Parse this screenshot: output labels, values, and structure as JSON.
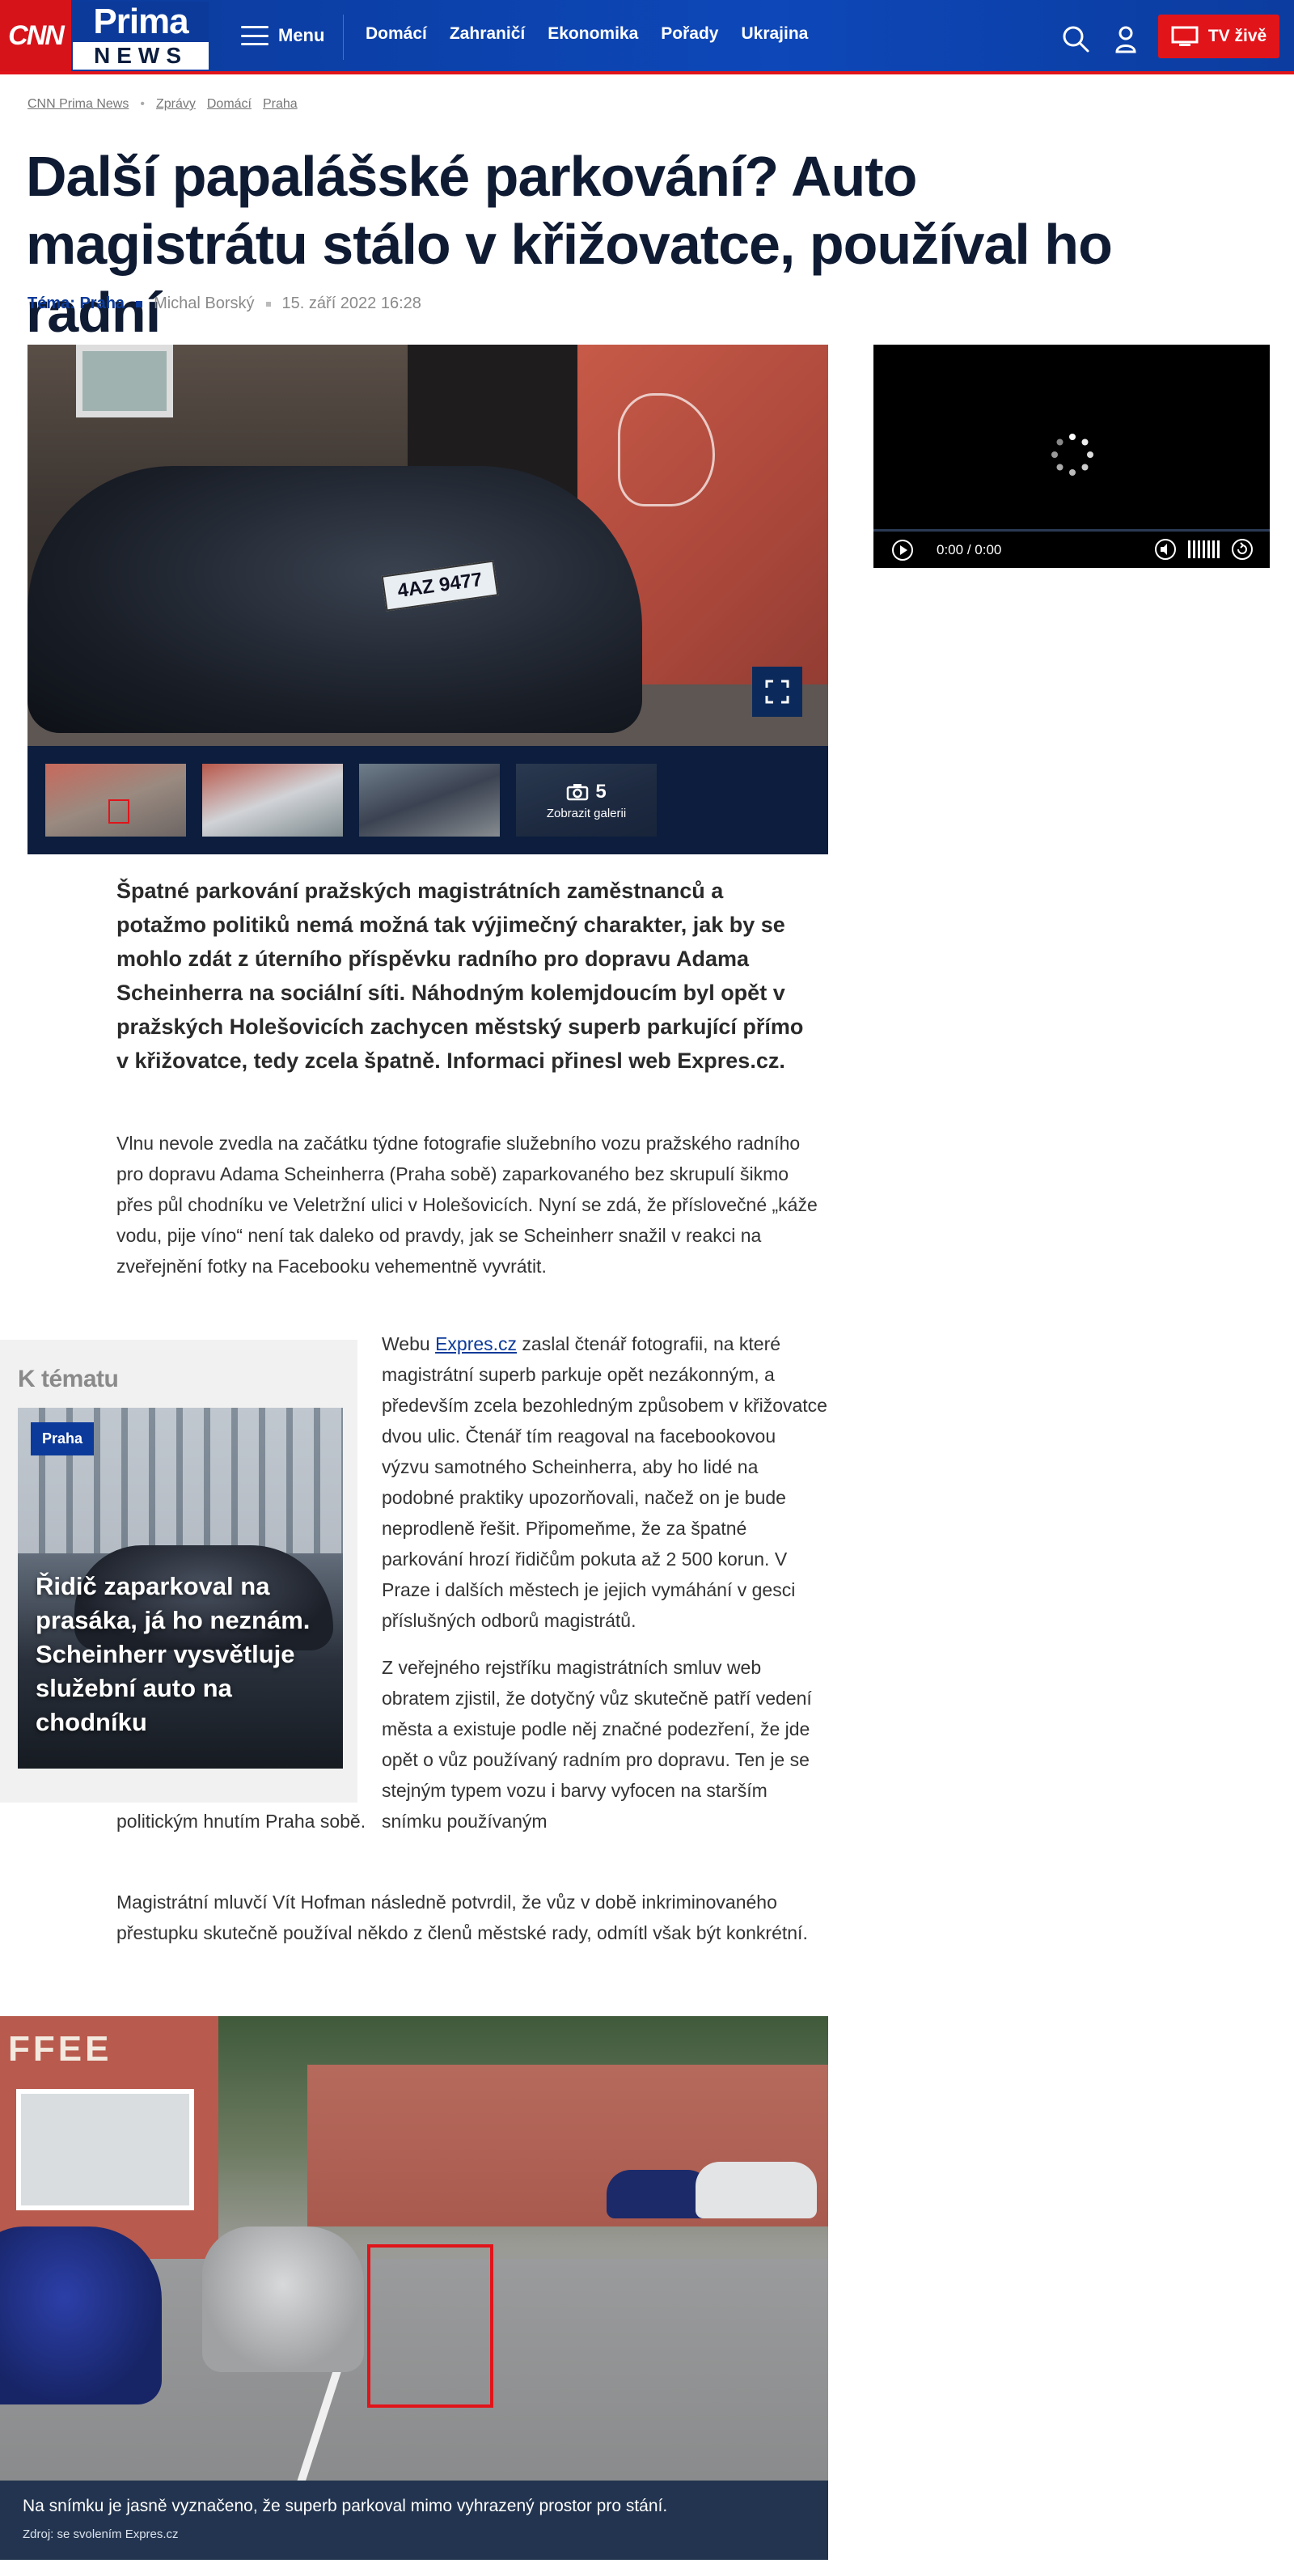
{
  "header": {
    "cnn_logo": "CNN",
    "prima_logo_top": "Prima",
    "prima_logo_bottom": "NEWS",
    "menu_label": "Menu",
    "nav": [
      "Domácí",
      "Zahraničí",
      "Ekonomika",
      "Pořady",
      "Ukrajina"
    ],
    "tv_label": "TV živě",
    "icons": [
      "search-icon",
      "user-icon",
      "tv-icon"
    ]
  },
  "breadcrumb": [
    "CNN Prima News",
    "Zprávy",
    "Domácí",
    "Praha"
  ],
  "article": {
    "title": "Další papalášské parkování? Auto magistrátu stálo v křižovatce, používal ho radní",
    "tema_label": "Téma: Praha",
    "author": "Michal Borský",
    "date": "15. září 2022 16:28",
    "hero_plate": "4AZ 9477",
    "perex": "Špatné parkování pražských magistrátních zaměstnanců a potažmo politiků nemá možná tak výjimečný charakter, jak by se mohlo zdát z úterního příspěvku radního pro dopravu Adama Scheinherra na sociální síti. Náhodným kolemjdoucím byl opět v pražských Holešovicích zachycen městský superb parkující přímo v křižovatce, tedy zcela špatně. Informaci přinesl web Expres.cz.",
    "p1": "Vlnu nevole zvedla na začátku týdne fotografie služebního vozu pražského radního pro dopravu Adama Scheinherra (Praha sobě) zaparkovaného bez skrupulí šikmo přes půl chodníku ve Veletržní ulici v Holešovicích. Nyní se zdá, že příslovečné „káže vodu, pije víno“ není tak daleko od pravdy, jak se Scheinherr snažil v reakci na zveřejnění fotky na Facebooku vehementně vyvrátit.",
    "p2_prefix": "Webu ",
    "p2_link": "Expres.cz",
    "p2_rest": " zaslal čtenář fotografii, na které magistrátní superb parkuje opět nezákonným, a především zcela bezohledným způsobem v křižovatce dvou ulic. Čtenář tím reagoval na facebookovou výzvu samotného Scheinherra, aby ho lidé na podobné praktiky upozorňovali, načež on je bude neprodleně řešit. Připomeňme, že za špatné parkování hrozí řidičům pokuta až 2 500 korun. V Praze i dalších městech je jejich vymáhání v gesci příslušných odborů magistrátů.",
    "p3": "Z veřejného rejstříku magistrátních smluv web obratem zjistil, že dotyčný vůz skutečně patří vedení města a existuje podle něj značné podezření, že jde opět o vůz používaný radním pro dopravu. Ten je se stejným typem vozu i barvy vyfocen na starším snímku používaným",
    "p3_end": "politickým hnutím Praha sobě.",
    "p4": "Magistrátní mluvčí Vít Hofman následně potvrdil, že vůz v době inkriminovaného přestupku skutečně používal někdo z členů městské rady, odmítl však být konkrétní."
  },
  "gallery": {
    "count": "5",
    "label": "Zobrazit galerii"
  },
  "video": {
    "time_current": "0:00",
    "time_sep": "/",
    "time_total": "0:00"
  },
  "related": {
    "heading": "K tématu",
    "tag": "Praha",
    "title": "Řidič zaparkoval na prasáka, já ho neznám. Scheinherr vysvětluje služební auto na chodníku"
  },
  "bottom_photo": {
    "shop_text": "FFEE",
    "caption": "Na snímku je jasně vyznačeno, že superb parkoval mimo vyhrazený prostor pro stání.",
    "source": "Zdroj: se svolením Expres.cz"
  },
  "colors": {
    "brand_blue": "#0b3a9a",
    "brand_red": "#e1141a",
    "title_dark": "#0f1b33"
  }
}
